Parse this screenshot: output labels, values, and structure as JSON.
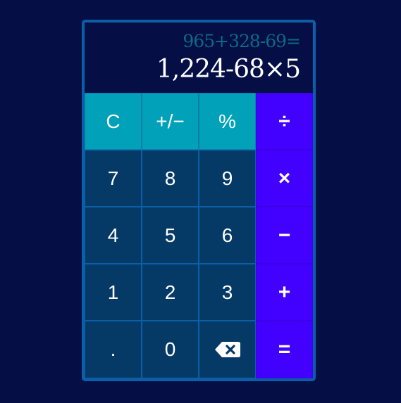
{
  "display": {
    "expression": "965+328-69=",
    "result": "1,224-68×5"
  },
  "keys": {
    "clear": "C",
    "sign": "+/−",
    "percent": "%",
    "divide": "÷",
    "seven": "7",
    "eight": "8",
    "nine": "9",
    "multiply": "×",
    "four": "4",
    "five": "5",
    "six": "6",
    "minus": "−",
    "one": "1",
    "two": "2",
    "three": "3",
    "plus": "+",
    "decimal": ".",
    "zero": "0",
    "backspace_icon": "backspace-icon",
    "equals": "="
  },
  "colors": {
    "background": "#050f45",
    "frame": "#0b5fa8",
    "function_key": "#00a1b9",
    "number_key": "#063a66",
    "operator_key": "#4200ff",
    "expression_text": "#0c6a86"
  }
}
